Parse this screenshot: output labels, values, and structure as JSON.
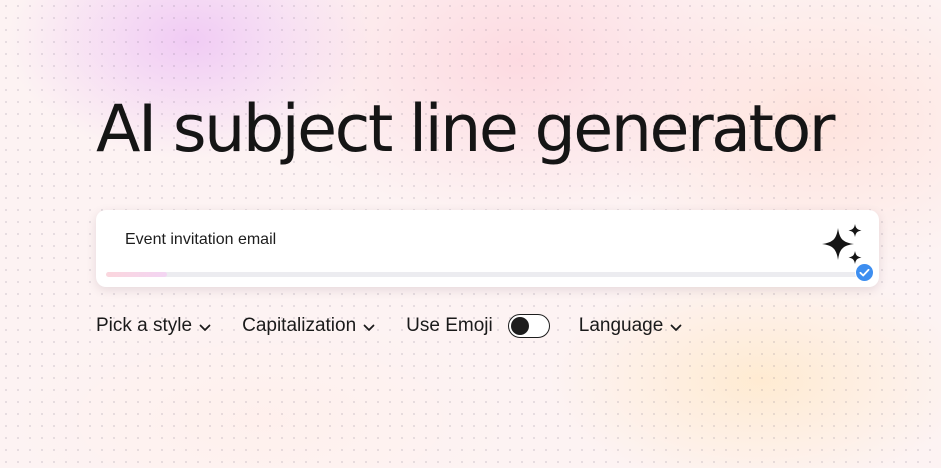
{
  "headline": "AI subject line generator",
  "input": {
    "value": "Event invitation email",
    "progress": 0.08
  },
  "options": {
    "style_label": "Pick a style",
    "capitalization_label": "Capitalization",
    "emoji_label": "Use Emoji",
    "emoji_enabled": false,
    "language_label": "Language"
  },
  "icons": {
    "generate": "sparkle-icon",
    "status": "check-badge-icon",
    "dropdown": "chevron-down-icon"
  },
  "colors": {
    "text": "#141414",
    "badge": "#3d8ef0",
    "progress_fill": "#fbd6dd"
  }
}
